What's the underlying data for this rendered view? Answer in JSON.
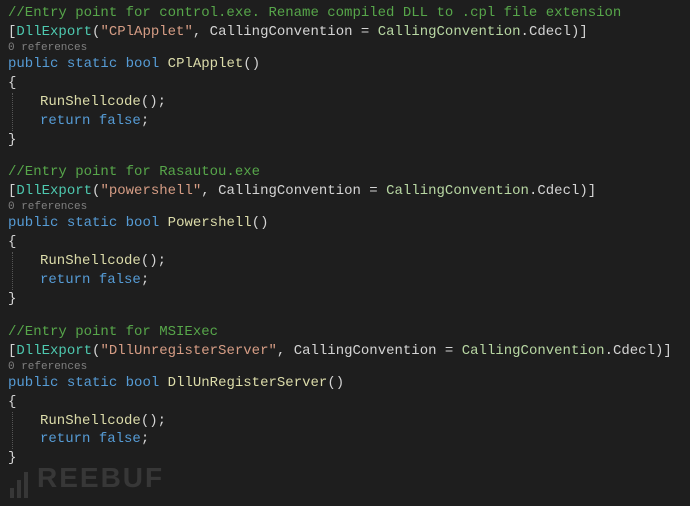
{
  "blocks": [
    {
      "comment": "//Entry point for control.exe. Rename compiled DLL to .cpl file extension",
      "attr_name": "DllExport",
      "attr_arg": "\"CPlApplet\"",
      "attr_param": "CallingConvention",
      "attr_enum_type": "CallingConvention",
      "attr_enum_member": "Cdecl",
      "references": "0 references",
      "kw_public": "public",
      "kw_static": "static",
      "kw_bool": "bool",
      "method_name": "CPlApplet",
      "call": "RunShellcode",
      "kw_return": "return",
      "kw_false": "false"
    },
    {
      "comment": "//Entry point for Rasautou.exe",
      "attr_name": "DllExport",
      "attr_arg": "\"powershell\"",
      "attr_param": "CallingConvention",
      "attr_enum_type": "CallingConvention",
      "attr_enum_member": "Cdecl",
      "references": "0 references",
      "kw_public": "public",
      "kw_static": "static",
      "kw_bool": "bool",
      "method_name": "Powershell",
      "call": "RunShellcode",
      "kw_return": "return",
      "kw_false": "false"
    },
    {
      "comment": "//Entry point for MSIExec",
      "attr_name": "DllExport",
      "attr_arg": "\"DllUnregisterServer\"",
      "attr_param": "CallingConvention",
      "attr_enum_type": "CallingConvention",
      "attr_enum_member": "Cdecl",
      "references": "0 references",
      "kw_public": "public",
      "kw_static": "static",
      "kw_bool": "bool",
      "method_name": "DllUnRegisterServer",
      "call": "RunShellcode",
      "kw_return": "return",
      "kw_false": "false"
    }
  ],
  "watermark": "REEBUF"
}
